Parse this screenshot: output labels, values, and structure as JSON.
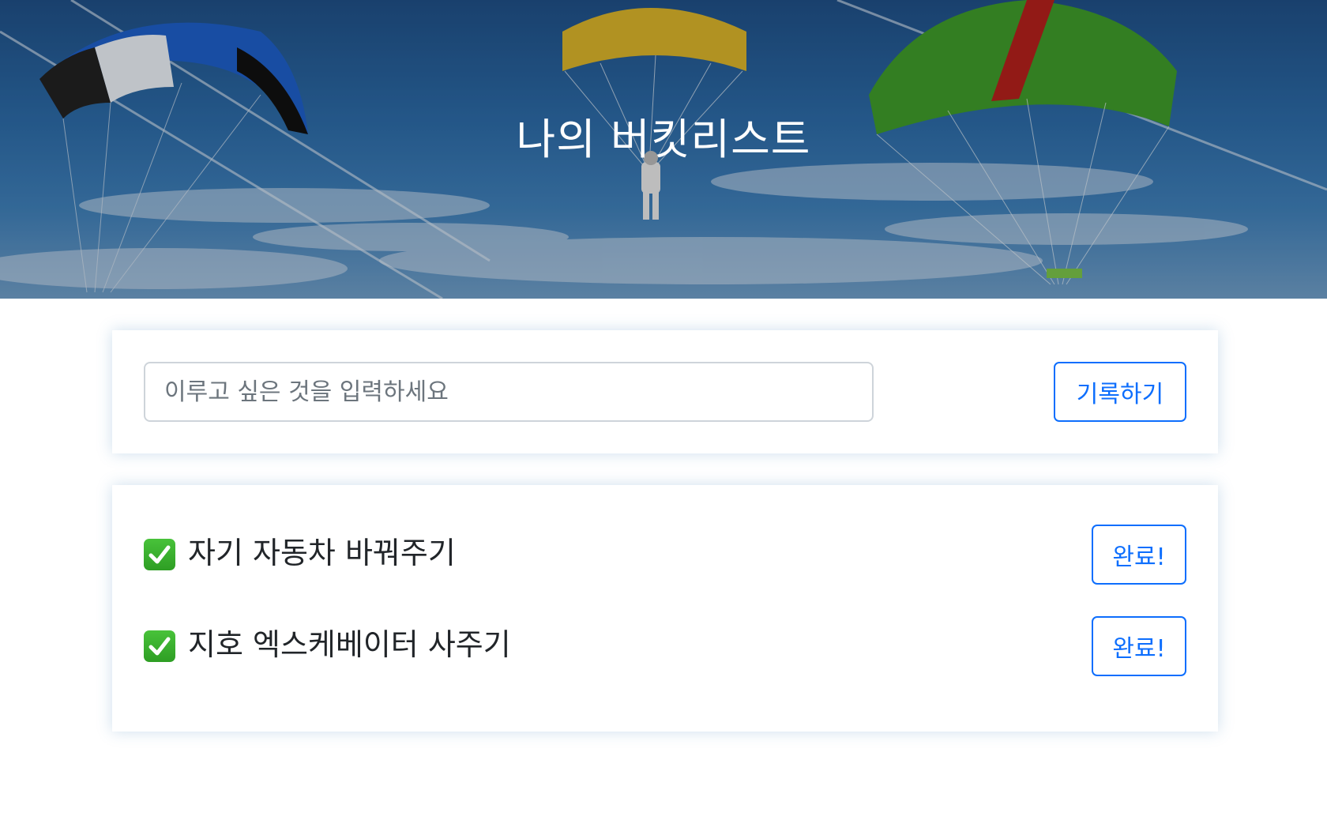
{
  "hero": {
    "title": "나의 버킷리스트"
  },
  "form": {
    "placeholder": "이루고 싶은 것을 입력하세요",
    "submit_label": "기록하기"
  },
  "bucket_list": {
    "items": [
      {
        "check_icon": "white-heavy-check-mark-icon",
        "text": "자기 자동차 바꿔주기",
        "button_label": "완료!"
      },
      {
        "check_icon": "white-heavy-check-mark-icon",
        "text": "지호 엑스케베이터 사주기",
        "button_label": "완료!"
      }
    ]
  },
  "colors": {
    "accent": "#0d6efd",
    "check_green": "#35a82a",
    "text": "#212529",
    "placeholder": "#6c757d"
  }
}
